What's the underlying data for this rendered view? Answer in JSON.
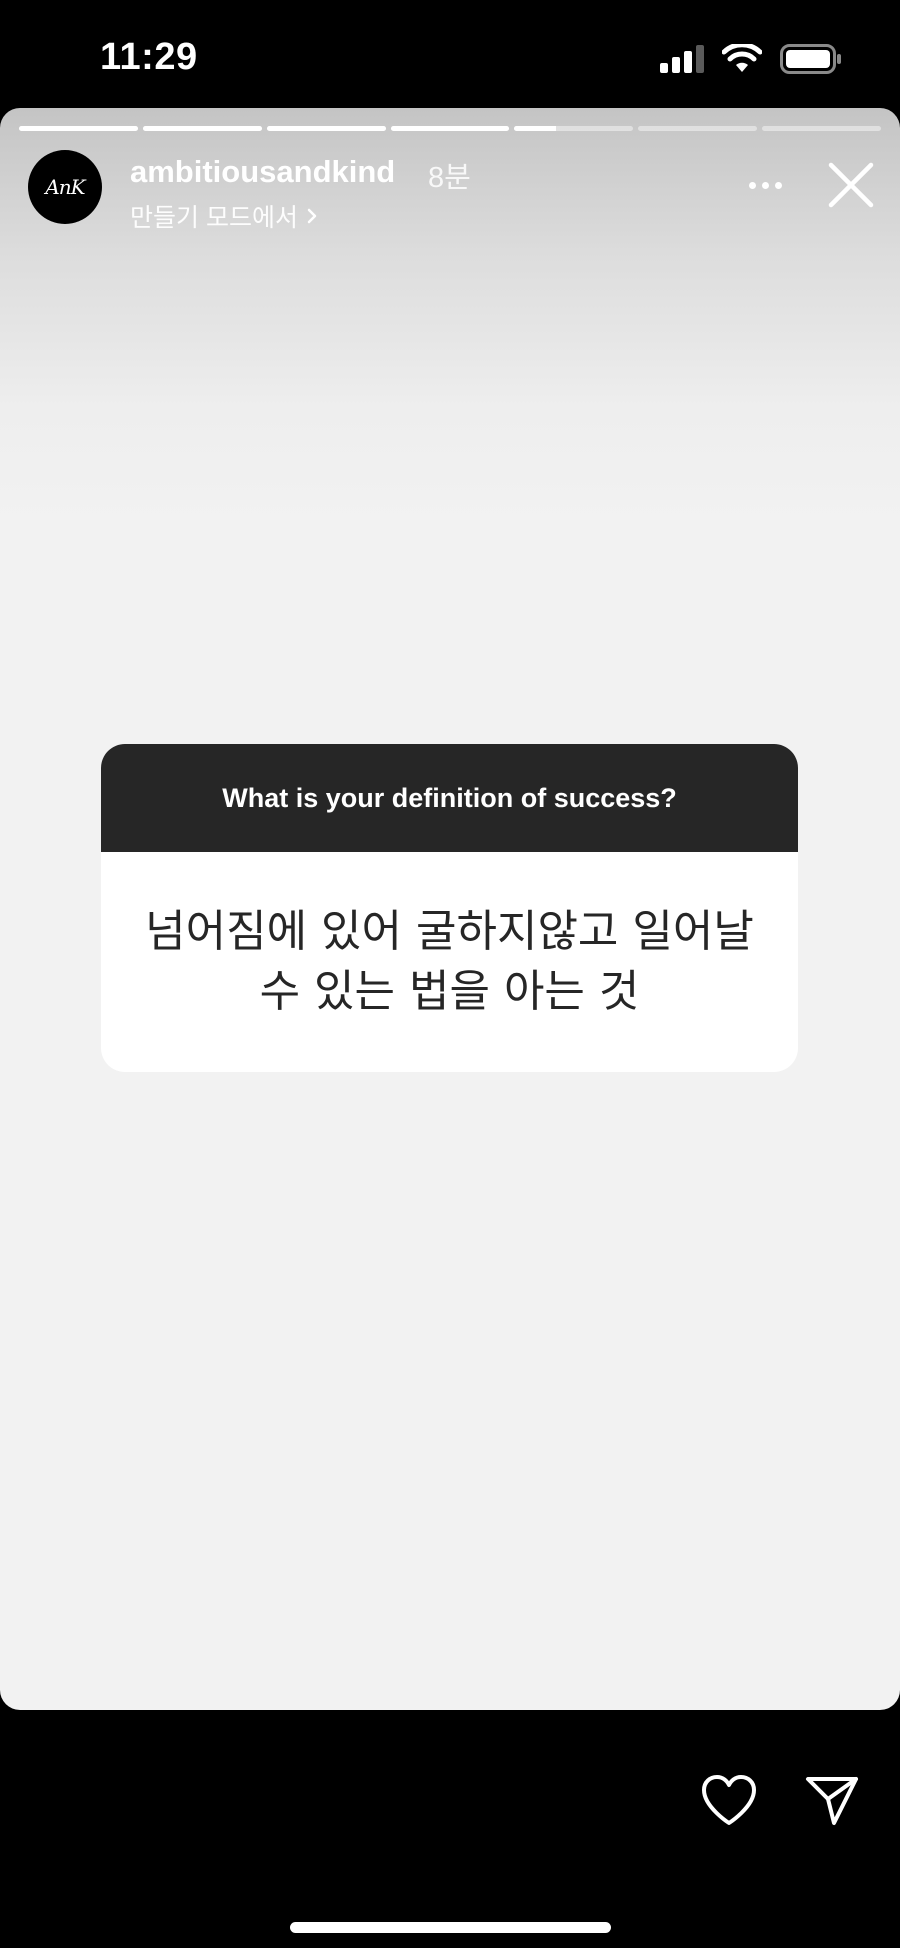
{
  "status_bar": {
    "time": "11:29",
    "icons": [
      "cellular-signal-icon",
      "wifi-icon",
      "battery-icon"
    ]
  },
  "story": {
    "progress": {
      "segments": 7,
      "completed": 4,
      "current_fraction": 0.35
    },
    "header": {
      "username": "ambitiousandkind",
      "time_ago": "8분",
      "subtitle": "만들기 모드에서",
      "avatar_text": "AnK"
    },
    "sticker": {
      "question": "What is your definition of success?",
      "answer": "넘어짐에 있어 굴하지않고 일어날 수 있는 법을 아는 것"
    }
  },
  "colors": {
    "sticker_header": "#262626",
    "background": "#f2f2f2",
    "frame": "#000000"
  }
}
